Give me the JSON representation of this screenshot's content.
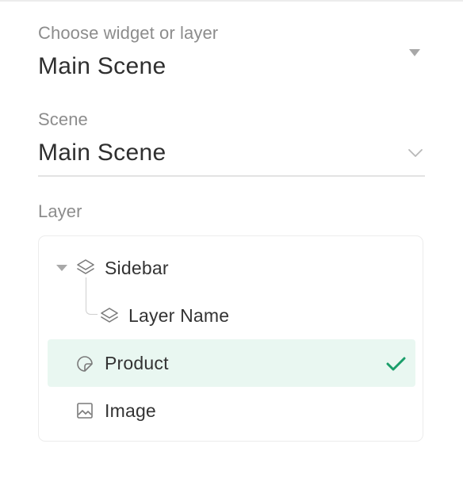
{
  "widget_select": {
    "label": "Choose widget or layer",
    "value": "Main Scene",
    "dropdown_icon": "caret-down-icon"
  },
  "scene_select": {
    "label": "Scene",
    "value": "Main Scene",
    "dropdown_icon": "chevron-down-icon"
  },
  "layer": {
    "label": "Layer",
    "items": [
      {
        "label": "Sidebar",
        "icon": "layers-icon",
        "expanded": true,
        "selected": false
      },
      {
        "label": "Layer Name",
        "icon": "layers-icon",
        "selected": false
      },
      {
        "label": "Product",
        "icon": "sticker-icon",
        "selected": true
      },
      {
        "label": "Image",
        "icon": "image-icon",
        "selected": false
      }
    ]
  },
  "colors": {
    "accent": "#1a9e6a",
    "selected_bg": "#e9f7f1"
  }
}
